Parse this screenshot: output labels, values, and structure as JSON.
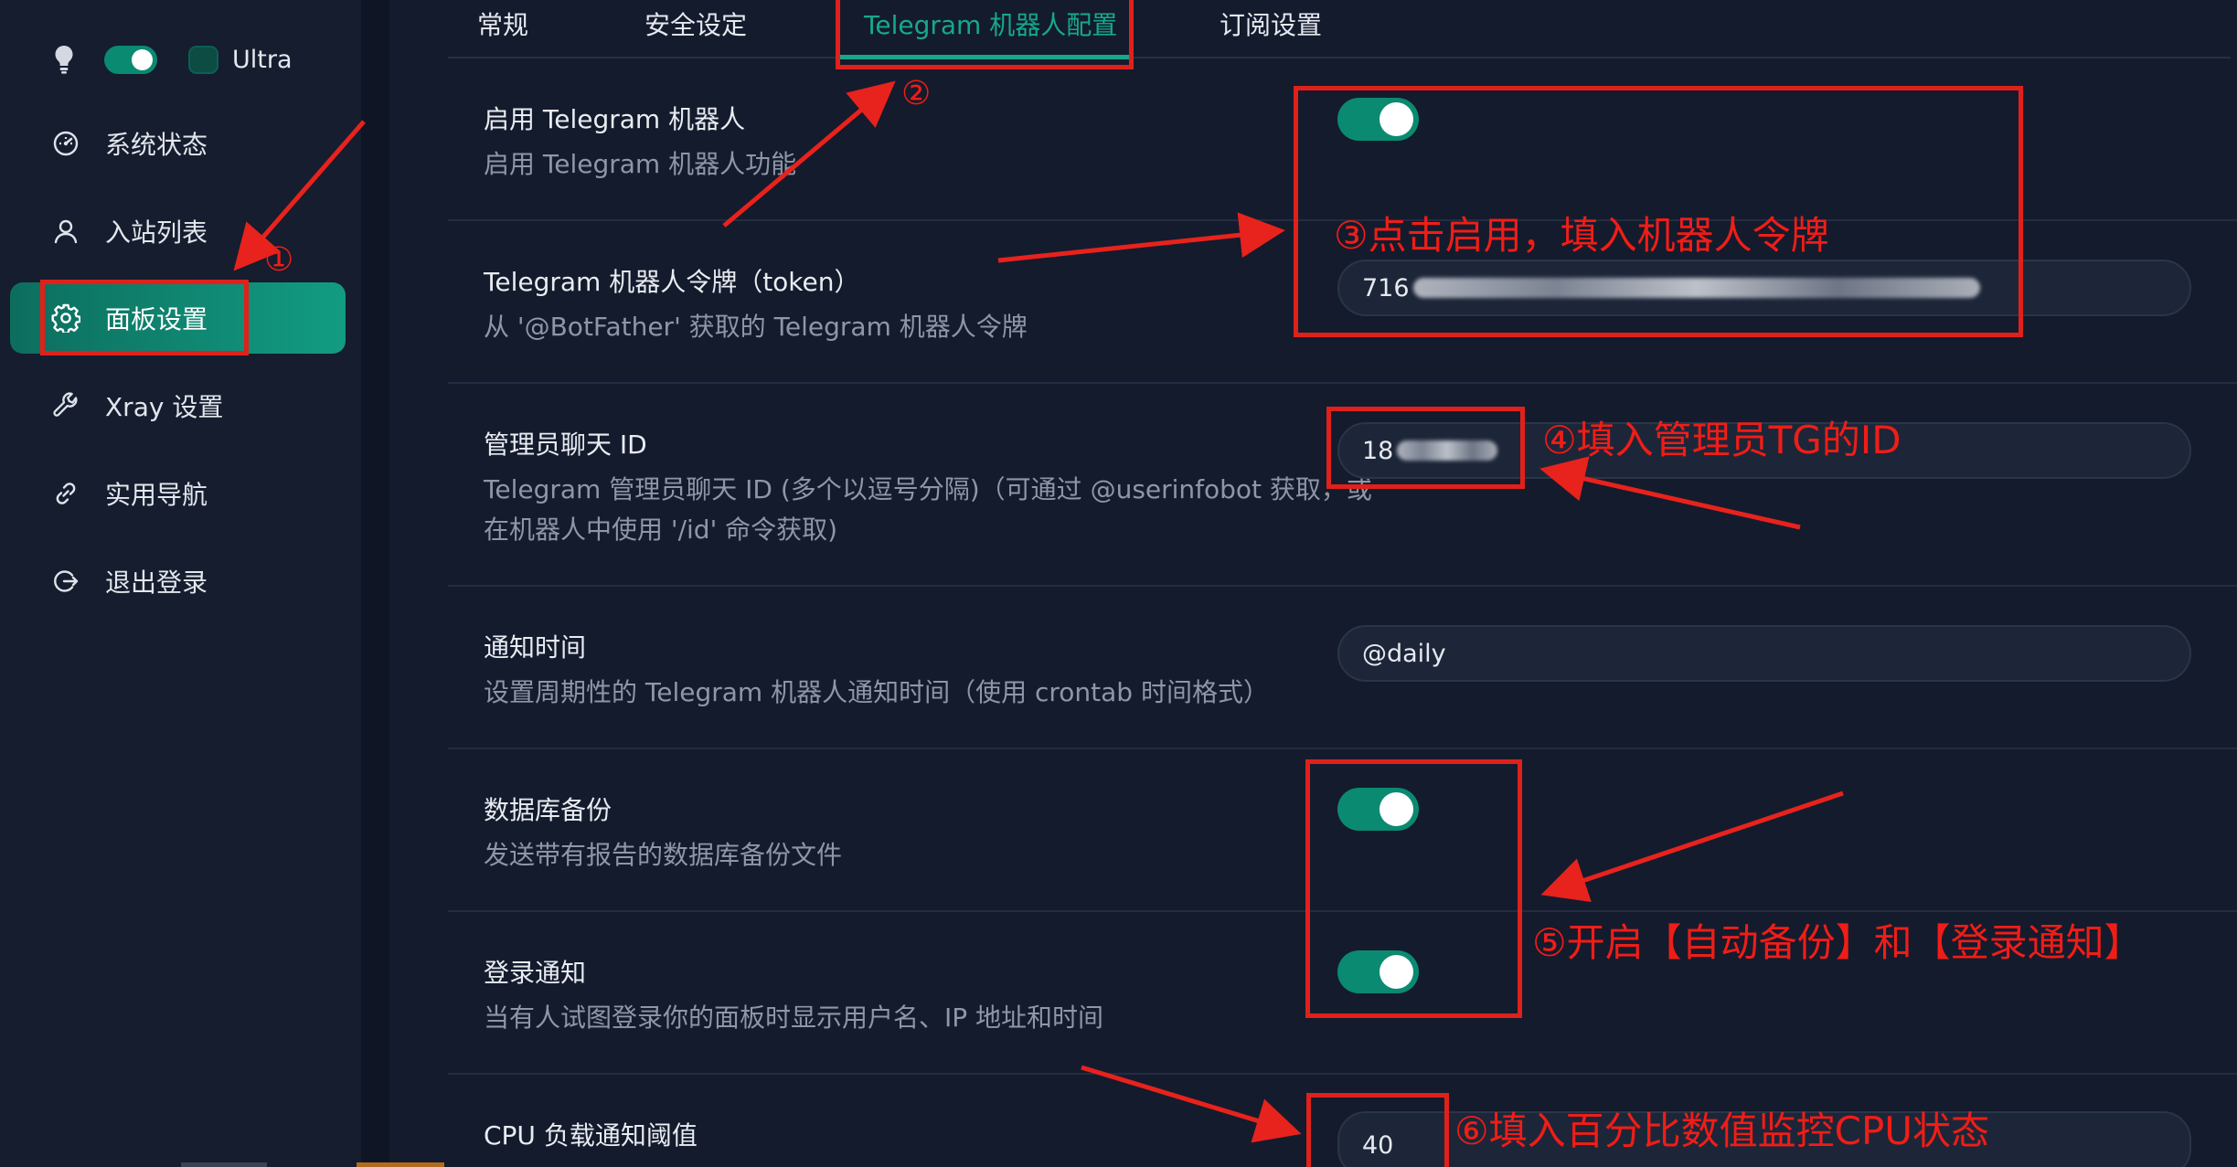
{
  "sidebar": {
    "theme_toggle_on": true,
    "ultra_label": "Ultra",
    "items": [
      {
        "label": "系统状态",
        "icon": "dashboard-icon",
        "active": false
      },
      {
        "label": "入站列表",
        "icon": "user-icon",
        "active": false
      },
      {
        "label": "面板设置",
        "icon": "gear-icon",
        "active": true
      },
      {
        "label": "Xray 设置",
        "icon": "wrench-icon",
        "active": false
      },
      {
        "label": "实用导航",
        "icon": "link-icon",
        "active": false
      },
      {
        "label": "退出登录",
        "icon": "logout-icon",
        "active": false
      }
    ]
  },
  "tabs": [
    {
      "label": "常规",
      "active": false
    },
    {
      "label": "安全设定",
      "active": false
    },
    {
      "label": "Telegram 机器人配置",
      "active": true
    },
    {
      "label": "订阅设置",
      "active": false
    }
  ],
  "settings": {
    "enable_bot": {
      "title": "启用 Telegram 机器人",
      "desc": "启用 Telegram 机器人功能",
      "enabled": true
    },
    "bot_token": {
      "title": "Telegram 机器人令牌（token）",
      "desc": "从 '@BotFather' 获取的 Telegram 机器人令牌",
      "value_visible": "716"
    },
    "admin_chat_id": {
      "title": "管理员聊天 ID",
      "desc_line1": "Telegram 管理员聊天 ID (多个以逗号分隔)（可通过 @userinfobot 获取，或",
      "desc_line2": "在机器人中使用 '/id' 命令获取)",
      "value_visible": "18"
    },
    "notify_time": {
      "title": "通知时间",
      "desc": "设置周期性的 Telegram 机器人通知时间（使用 crontab 时间格式）",
      "value": "@daily"
    },
    "db_backup": {
      "title": "数据库备份",
      "desc": "发送带有报告的数据库备份文件",
      "enabled": true
    },
    "login_notify": {
      "title": "登录通知",
      "desc": "当有人试图登录你的面板时显示用户名、IP 地址和时间",
      "enabled": true
    },
    "cpu_threshold": {
      "title": "CPU 负载通知阈值",
      "value": "40"
    }
  },
  "annotations": {
    "c1": "①",
    "c2": "②",
    "a3": "③点击启用，填入机器人令牌",
    "a4": "④填入管理员TG的ID",
    "a5": "⑤开启【自动备份】和【登录通知】",
    "a6": "⑥填入百分比数值监控CPU状态",
    "color": "#e0211b"
  },
  "colors": {
    "accent": "#16a88c",
    "background": "#141b2d",
    "sidebar": "#151d2f"
  }
}
